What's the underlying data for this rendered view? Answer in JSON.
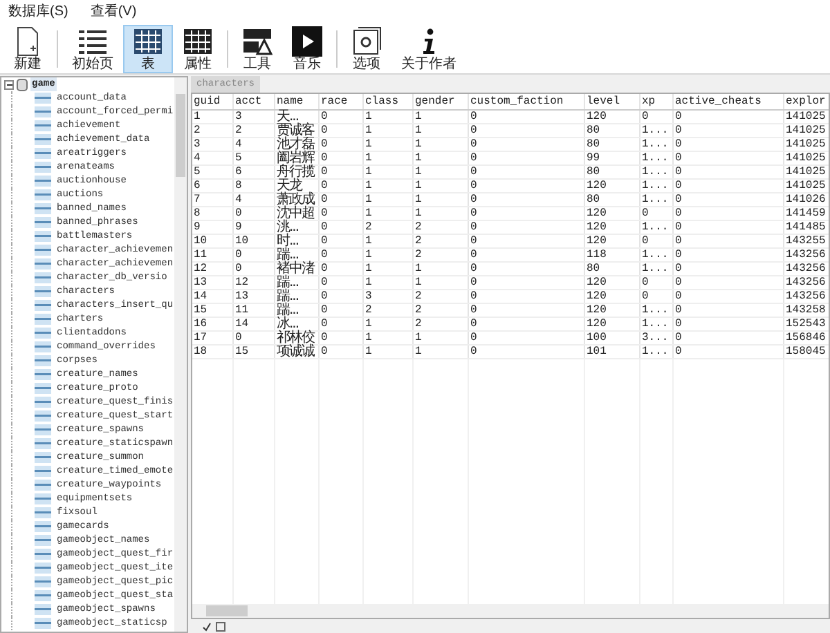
{
  "menu": [
    {
      "label": "数据库(S)"
    },
    {
      "label": "查看(V)"
    }
  ],
  "toolbar": [
    {
      "kind": "new",
      "label": "新建",
      "selected": false
    },
    {
      "kind": "list",
      "label": "初始页",
      "selected": false
    },
    {
      "kind": "grid",
      "label": "表",
      "selected": true
    },
    {
      "kind": "grid-dark",
      "label": "属性",
      "selected": false
    },
    {
      "kind": "tools",
      "label": "工具",
      "selected": false
    },
    {
      "kind": "play",
      "label": "音乐",
      "selected": false
    },
    {
      "kind": "options",
      "label": "选项",
      "selected": false
    },
    {
      "kind": "info",
      "label": "关于作者",
      "selected": false
    }
  ],
  "tree": {
    "label": "game",
    "expanded": true,
    "children": [
      "account_data",
      "account_forced_permi",
      "achievement",
      "achievement_data",
      "areatriggers",
      "arenateams",
      "auctionhouse",
      "auctions",
      "banned_names",
      "banned_phrases",
      "battlemasters",
      "character_achievemen",
      "character_achievemen",
      "character_db_versio",
      "characters",
      "characters_insert_qu",
      "charters",
      "clientaddons",
      "command_overrides",
      "corpses",
      "creature_names",
      "creature_proto",
      "creature_quest_finis",
      "creature_quest_start",
      "creature_spawns",
      "creature_staticspawn",
      "creature_summon",
      "creature_timed_emote",
      "creature_waypoints",
      "equipmentsets",
      "fixsoul",
      "gamecards",
      "gameobject_names",
      "gameobject_quest_fir",
      "gameobject_quest_ite",
      "gameobject_quest_pic",
      "gameobject_quest_sta",
      "gameobject_spawns",
      "gameobject_staticsp"
    ]
  },
  "tab": {
    "label": "characters"
  },
  "table": {
    "columns": [
      "guid",
      "acct",
      "name",
      "race",
      "class",
      "gender",
      "custom_faction",
      "level",
      "xp",
      "active_cheats",
      "explor"
    ],
    "rows": [
      [
        "1",
        "3",
        "天...",
        "0",
        "1",
        "1",
        "0",
        "120",
        "0",
        "0",
        "141025"
      ],
      [
        "2",
        "2",
        "贾诚客",
        "0",
        "1",
        "1",
        "0",
        "80",
        "1...",
        "0",
        "141025"
      ],
      [
        "3",
        "4",
        "池才磊",
        "0",
        "1",
        "1",
        "0",
        "80",
        "1...",
        "0",
        "141025"
      ],
      [
        "4",
        "5",
        "阖岩辉",
        "0",
        "1",
        "1",
        "0",
        "99",
        "1...",
        "0",
        "141025"
      ],
      [
        "5",
        "6",
        "舟行揽",
        "0",
        "1",
        "1",
        "0",
        "80",
        "1...",
        "0",
        "141025"
      ],
      [
        "6",
        "8",
        "天龙",
        "0",
        "1",
        "1",
        "0",
        "120",
        "1...",
        "0",
        "141025"
      ],
      [
        "7",
        "4",
        "萧政成",
        "0",
        "1",
        "1",
        "0",
        "80",
        "1...",
        "0",
        "141026"
      ],
      [
        "8",
        "0",
        "沈中超",
        "0",
        "1",
        "1",
        "0",
        "120",
        "0",
        "0",
        "141459"
      ],
      [
        "9",
        "9",
        "洮...",
        "0",
        "2",
        "2",
        "0",
        "120",
        "1...",
        "0",
        "141485"
      ],
      [
        "10",
        "10",
        "时...",
        "0",
        "1",
        "2",
        "0",
        "120",
        "0",
        "0",
        "143255"
      ],
      [
        "11",
        "0",
        "踹...",
        "0",
        "1",
        "2",
        "0",
        "118",
        "1...",
        "0",
        "143256"
      ],
      [
        "12",
        "0",
        "褚中渚",
        "0",
        "1",
        "1",
        "0",
        "80",
        "1...",
        "0",
        "143256"
      ],
      [
        "13",
        "12",
        "踹...",
        "0",
        "1",
        "1",
        "0",
        "120",
        "0",
        "0",
        "143256"
      ],
      [
        "14",
        "13",
        "踹...",
        "0",
        "3",
        "2",
        "0",
        "120",
        "0",
        "0",
        "143256"
      ],
      [
        "15",
        "11",
        "踹...",
        "0",
        "2",
        "2",
        "0",
        "120",
        "1...",
        "0",
        "143258"
      ],
      [
        "16",
        "14",
        "冰...",
        "0",
        "1",
        "2",
        "0",
        "120",
        "1...",
        "0",
        "152543"
      ],
      [
        "17",
        "0",
        "祁林佼",
        "0",
        "1",
        "1",
        "0",
        "100",
        "3...",
        "0",
        "156846"
      ],
      [
        "18",
        "15",
        "项诚诚",
        "0",
        "1",
        "1",
        "0",
        "101",
        "1...",
        "0",
        "158045"
      ]
    ]
  }
}
